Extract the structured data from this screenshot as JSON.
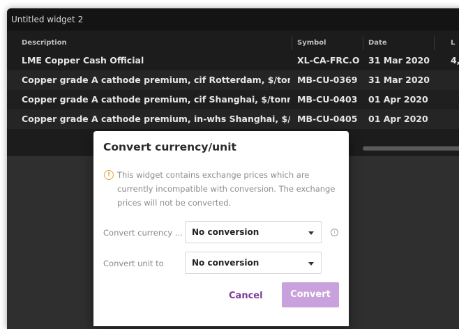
{
  "widget": {
    "title": "Untitled widget 2"
  },
  "table": {
    "columns": [
      "Description",
      "Symbol",
      "Date",
      "L"
    ],
    "rows": [
      [
        "LME Copper Cash Official",
        "XL-CA-FRC.O",
        "31 Mar 2020",
        "4,"
      ],
      [
        "Copper grade A cathode premium, cif Rotterdam, $/tonne",
        "MB-CU-0369",
        "31 Mar 2020",
        ""
      ],
      [
        "Copper grade A cathode premium, cif Shanghai, $/tonne",
        "MB-CU-0403",
        "01 Apr 2020",
        ""
      ],
      [
        "Copper grade A cathode premium, in-whs Shanghai, $/tonne",
        "MB-CU-0405",
        "01 Apr 2020",
        ""
      ]
    ]
  },
  "dialog": {
    "title": "Convert currency/unit",
    "warning": "This widget contains exchange prices which are currently incompatible with conversion. The exchange prices will not be converted.",
    "fields": {
      "currency": {
        "label": "Convert currency ...",
        "value": "No conversion"
      },
      "unit": {
        "label": "Convert unit to",
        "value": "No conversion"
      }
    },
    "buttons": {
      "cancel": "Cancel",
      "convert": "Convert"
    }
  },
  "colors": {
    "accent": "#7d3c98",
    "primary_button": "#c9a1dc",
    "warning": "#e8a33a"
  },
  "icons": {
    "warning": "warning-circle-icon",
    "info": "info-icon",
    "dropdown": "chevron-down-icon"
  }
}
